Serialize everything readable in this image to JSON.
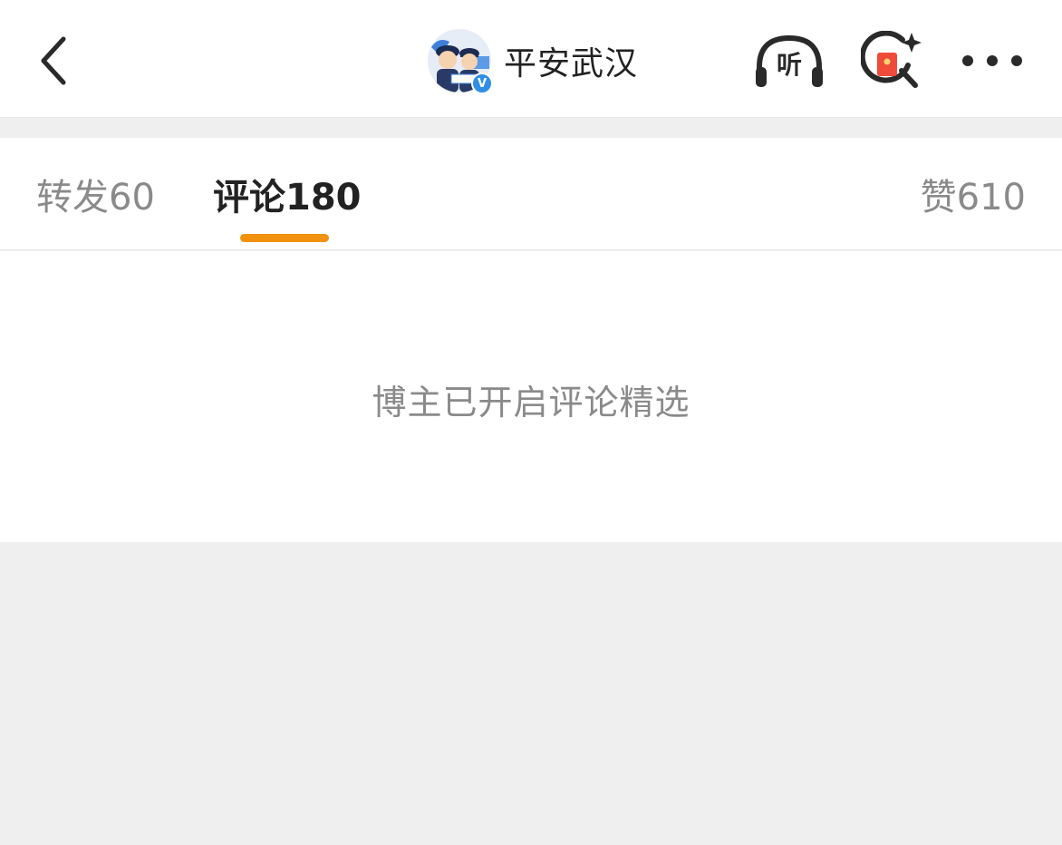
{
  "header": {
    "account_name": "平安武汉",
    "verified_badge": "V",
    "listen_label": "听",
    "icons": [
      "back-arrow-icon",
      "listen-headphone-icon",
      "red-packet-search-icon",
      "more-dots-icon"
    ]
  },
  "tabs": [
    {
      "label": "转发",
      "count": "60",
      "active": false
    },
    {
      "label": "评论",
      "count": "180",
      "active": true
    },
    {
      "label": "赞",
      "count": "610",
      "active": false
    }
  ],
  "notice": {
    "text": "博主已开启评论精选"
  },
  "colors": {
    "accent": "#f0920e",
    "verified": "#2f8fe6",
    "red_packet": "#f04a3a",
    "text_primary": "#222222",
    "text_secondary": "#8a8a8a",
    "background": "#efefef"
  }
}
